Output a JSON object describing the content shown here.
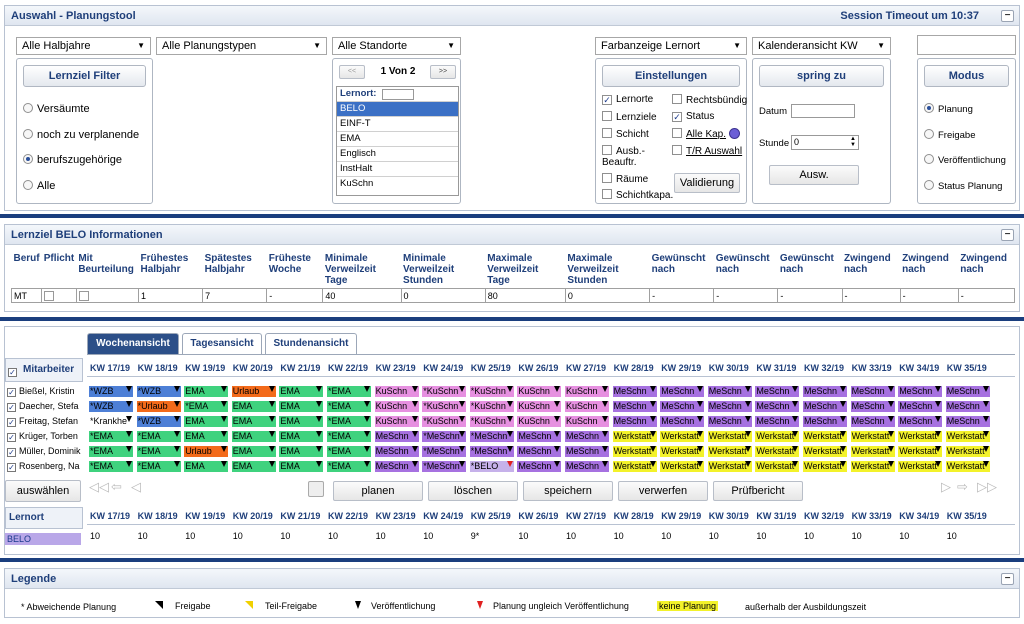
{
  "top": {
    "title": "Auswahl - Planungstool",
    "session": "Session Timeout um  10:37",
    "filters": {
      "halbjahre": "Alle Halbjahre",
      "planungstypen": "Alle Planungstypen",
      "standorte": "Alle Standorte"
    },
    "lernziel_filter": "Lernziel Filter",
    "radios": [
      "Versäumte",
      "noch zu verplanende",
      "berufszugehörige",
      "Alle"
    ],
    "pager": {
      "prev": "<<",
      "page": "1 Von 2",
      "next": ">>"
    },
    "lernort_label": "Lernort:",
    "lernorte": [
      "BELO",
      "EINF-T",
      "EMA",
      "Englisch",
      "InstHalt",
      "KuSchn"
    ],
    "farbanzeige": "Farbanzeige Lernort",
    "kalender": "Kalenderansicht KW",
    "einstellungen": "Einstellungen",
    "checks": {
      "lernorte": "Lernorte",
      "rechtsbuendig": "Rechtsbündig",
      "lernziele": "Lernziele",
      "status": "Status",
      "schicht": "Schicht",
      "alle_kap": "Alle Kap.",
      "ausb": "Ausb.-",
      "beauftr": "Beauftr.",
      "tr_auswahl": "T/R Auswahl",
      "raeume": "Räume",
      "schichtkapa": "Schichtkapa."
    },
    "validierung": "Validierung",
    "spring_zu": "spring zu",
    "datum": "Datum",
    "stunde": "Stunde",
    "stunde_val": "0",
    "ausw": "Ausw.",
    "modus": "Modus",
    "modus_radios": [
      "Planung",
      "Freigabe",
      "Veröffentlichung",
      "Status Planung"
    ]
  },
  "info": {
    "title": "Lernziel BELO Informationen",
    "headers": [
      "Beruf",
      "Pflicht",
      "Mit Beurteilung",
      "Frühestes Halbjahr",
      "Spätestes Halbjahr",
      "Früheste Woche",
      "Minimale Verweilzeit Tage",
      "Minimale Verweilzeit Stunden",
      "Maximale Verweilzeit Tage",
      "Maximale Verweilzeit Stunden",
      "Gewünscht nach",
      "Gewünscht nach",
      "Gewünscht nach",
      "Zwingend nach",
      "Zwingend nach",
      "Zwingend nach"
    ],
    "row": [
      "MT",
      "",
      "",
      "1",
      "7",
      "-",
      "40",
      "0",
      "80",
      "0",
      "-",
      "-",
      "-",
      "-",
      "-",
      "-"
    ]
  },
  "plan": {
    "tabs": [
      "Wochenansicht",
      "Tagesansicht",
      "Stundenansicht"
    ],
    "mitarbeiter": "Mitarbeiter",
    "weeks": [
      "KW 17/19",
      "KW 18/19",
      "KW 19/19",
      "KW 20/19",
      "KW 21/19",
      "KW 22/19",
      "KW 23/19",
      "KW 24/19",
      "KW 25/19",
      "KW 26/19",
      "KW 27/19",
      "KW 28/19",
      "KW 29/19",
      "KW 30/19",
      "KW 31/19",
      "KW 32/19",
      "KW 33/19",
      "KW 34/19",
      "KW 35/19"
    ],
    "employees": [
      "Bießel, Kristin",
      "Daecher, Stefa",
      "Freitag, Stefan",
      "Krüger, Torben",
      "Müller, Dominik",
      "Rosenberg, Na"
    ],
    "rows": [
      [
        "*WZB|blue",
        "*WZB|blue",
        "EMA|green",
        "Urlaub|orange",
        "EMA|green",
        "*EMA|green",
        "KuSchn|pink",
        "*KuSchn|pink",
        "*KuSchn|pink",
        "KuSchn|pink",
        "KuSchn|pink",
        "MeSchn|purple",
        "MeSchn|purple",
        "MeSchn|purple",
        "MeSchn|purple",
        "MeSchn|purple",
        "MeSchn|purple",
        "MeSchn|purple",
        "MeSchn|purple"
      ],
      [
        "*WZB|blue",
        "*Urlaub|orange",
        "*EMA|green",
        "EMA|green",
        "EMA|green",
        "*EMA|green",
        "KuSchn|pink",
        "*KuSchn|pink",
        "*KuSchn|pink",
        "KuSchn|pink",
        "KuSchn|pink",
        "MeSchn|purple",
        "MeSchn|purple",
        "MeSchn|purple",
        "MeSchn|purple",
        "MeSchn|purple",
        "MeSchn|purple",
        "MeSchn|purple",
        "MeSchn|purple"
      ],
      [
        "*Krankhe|white",
        "*WZB|blue",
        "EMA|green",
        "EMA|green",
        "EMA|green",
        "*EMA|green",
        "KuSchn|pink",
        "*KuSchn|pink",
        "*KuSchn|pink",
        "KuSchn|pink",
        "KuSchn|pink",
        "MeSchn|purple",
        "MeSchn|purple",
        "MeSchn|purple",
        "MeSchn|purple",
        "MeSchn|purple",
        "MeSchn|purple",
        "MeSchn|purple",
        "MeSchn|purple"
      ],
      [
        "*EMA|green",
        "*EMA|green",
        "EMA|green",
        "EMA|green",
        "EMA|green",
        "*EMA|green",
        "MeSchn|purple",
        "*MeSchn|purple",
        "*MeSchn|purple",
        "MeSchn|purple",
        "MeSchn|purple",
        "Werkstatt|yellow",
        "Werkstatt|yellow",
        "Werkstatt|yellow",
        "Werkstatt|yellow",
        "Werkstatt|yellow",
        "Werkstatt|yellow",
        "Werkstatt|yellow",
        "Werkstatt|yellow"
      ],
      [
        "*EMA|green",
        "*EMA|green",
        "Urlaub|orange",
        "EMA|green",
        "EMA|green",
        "*EMA|green",
        "MeSchn|purple",
        "*MeSchn|purple",
        "*MeSchn|purple",
        "MeSchn|purple",
        "MeSchn|purple",
        "Werkstatt|yellow",
        "Werkstatt|yellow",
        "Werkstatt|yellow",
        "Werkstatt|yellow",
        "Werkstatt|yellow",
        "Werkstatt|yellow",
        "Werkstatt|yellow",
        "Werkstatt|yellow"
      ],
      [
        "*EMA|green",
        "*EMA|green",
        "EMA|green",
        "EMA|green",
        "EMA|green",
        "*EMA|green",
        "MeSchn|purple",
        "*MeSchn|purple",
        "*BELO|lav",
        "MeSchn|purple",
        "MeSchn|purple",
        "Werkstatt|yellow",
        "Werkstatt|yellow",
        "Werkstatt|yellow",
        "Werkstatt|yellow",
        "Werkstatt|yellow",
        "Werkstatt|yellow",
        "Werkstatt|yellow",
        "Werkstatt|yellow"
      ]
    ],
    "auswaehlen": "auswählen",
    "actions": [
      "planen",
      "löschen",
      "speichern",
      "verwerfen",
      "Prüfbericht"
    ],
    "lernort": "Lernort",
    "lernort_val": "BELO",
    "capacity": [
      "10",
      "10",
      "10",
      "10",
      "10",
      "10",
      "10",
      "10",
      "9*",
      "10",
      "10",
      "10",
      "10",
      "10",
      "10",
      "10",
      "10",
      "10",
      "10"
    ]
  },
  "legend": {
    "title": "Legende",
    "items": [
      "* Abweichende Planung",
      "Freigabe",
      "Teil-Freigabe",
      "Veröffentlichung",
      "Planung ungleich Veröffentlichung",
      "keine Planung",
      "außerhalb der Ausbildungszeit"
    ]
  },
  "colors": {
    "blue": "#4d7fd6",
    "orange": "#f36a1a",
    "green": "#3fd27e",
    "pink": "#e690e0",
    "purple": "#a671e0",
    "yellow": "#f3f22a",
    "accent": "#1f3f7a"
  }
}
